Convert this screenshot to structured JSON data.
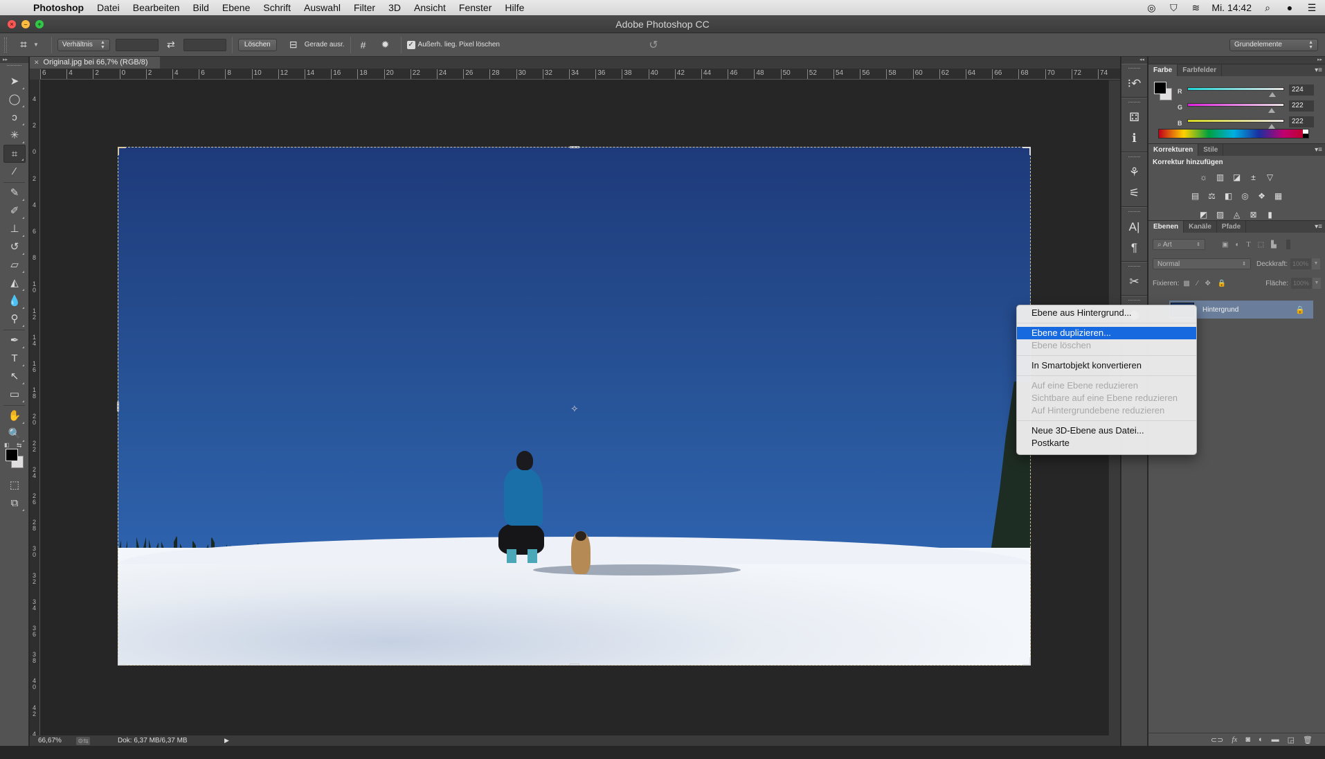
{
  "menubar": {
    "app_name": "Photoshop",
    "items": [
      "Datei",
      "Bearbeiten",
      "Bild",
      "Ebene",
      "Schrift",
      "Auswahl",
      "Filter",
      "3D",
      "Ansicht",
      "Fenster",
      "Hilfe"
    ],
    "clock": "Mi. 14:42",
    "status_icons": [
      "creative-cloud-icon",
      "shield-icon",
      "wifi-icon",
      "spotlight-icon",
      "siri-icon",
      "notification-center-icon"
    ]
  },
  "window": {
    "title": "Adobe Photoshop CC"
  },
  "options_bar": {
    "ratio_select": "Verhältnis",
    "width_value": "",
    "height_value": "",
    "clear_button": "Löschen",
    "straighten_label": "Gerade ausr.",
    "delete_cropped_label": "Außerh. lieg. Pixel löschen",
    "delete_cropped_checked": true,
    "workspace_select": "Grundelemente"
  },
  "document": {
    "tab_title": "Original.jpg bei 66,7% (RGB/8)",
    "zoom": "66,67%",
    "doc_size": "Dok: 6,37 MB/6,37 MB"
  },
  "rulers": {
    "top_labels": [
      "6",
      "4",
      "2",
      "0",
      "2",
      "4",
      "6",
      "8",
      "10",
      "12",
      "14",
      "16",
      "18",
      "20",
      "22",
      "24",
      "26",
      "28",
      "30",
      "32",
      "34",
      "36",
      "38",
      "40",
      "42",
      "44",
      "46",
      "48",
      "50",
      "52",
      "54",
      "56",
      "58",
      "60",
      "62",
      "64",
      "66",
      "68",
      "70",
      "72",
      "74"
    ],
    "left_labels": [
      "4",
      "2",
      "0",
      "2",
      "4",
      "6",
      "8",
      "10",
      "12",
      "14",
      "16",
      "18",
      "20",
      "22",
      "24",
      "26",
      "28",
      "30",
      "32",
      "34",
      "36",
      "38",
      "40",
      "42",
      "4"
    ]
  },
  "tools": [
    {
      "name": "move-tool",
      "glyph": "➤"
    },
    {
      "name": "marquee-tool",
      "glyph": "◯"
    },
    {
      "name": "lasso-tool",
      "glyph": "ↄ"
    },
    {
      "name": "magic-wand-tool",
      "glyph": "✳"
    },
    {
      "name": "crop-tool",
      "glyph": "⌗",
      "active": true
    },
    {
      "name": "eyedropper-tool",
      "glyph": "⁄"
    },
    {
      "name": "healing-brush-tool",
      "glyph": "✎"
    },
    {
      "name": "brush-tool",
      "glyph": "✐"
    },
    {
      "name": "clone-stamp-tool",
      "glyph": "⊥"
    },
    {
      "name": "history-brush-tool",
      "glyph": "↺"
    },
    {
      "name": "eraser-tool",
      "glyph": "▱"
    },
    {
      "name": "paint-bucket-tool",
      "glyph": "◭"
    },
    {
      "name": "blur-tool",
      "glyph": "💧"
    },
    {
      "name": "dodge-tool",
      "glyph": "⚲"
    },
    {
      "name": "pen-tool",
      "glyph": "✒"
    },
    {
      "name": "type-tool",
      "glyph": "T"
    },
    {
      "name": "path-selection-tool",
      "glyph": "↖"
    },
    {
      "name": "rectangle-tool",
      "glyph": "▭"
    },
    {
      "name": "hand-tool",
      "glyph": "✋"
    },
    {
      "name": "zoom-tool",
      "glyph": "🔍"
    }
  ],
  "panels": {
    "color": {
      "tabs": [
        "Farbe",
        "Farbfelder"
      ],
      "active_tab": "Farbe",
      "channels": [
        {
          "label": "R",
          "value": "224",
          "fraction": 0.878,
          "color": "#20d8d8"
        },
        {
          "label": "G",
          "value": "222",
          "fraction": 0.871,
          "color": "#e020e0"
        },
        {
          "label": "B",
          "value": "222",
          "fraction": 0.871,
          "color": "#d8d820"
        }
      ],
      "foreground": "#000000",
      "background": "#e0dede"
    },
    "adjustments": {
      "tabs": [
        "Korrekturen",
        "Stile"
      ],
      "active_tab": "Korrekturen",
      "title": "Korrektur hinzufügen",
      "rows": [
        [
          "brightness-contrast-icon",
          "levels-icon",
          "curves-icon",
          "exposure-icon",
          "vibrance-icon"
        ],
        [
          "hue-saturation-icon",
          "color-balance-icon",
          "black-white-icon",
          "photo-filter-icon",
          "channel-mixer-icon",
          "color-lookup-icon"
        ],
        [
          "invert-icon",
          "posterize-icon",
          "threshold-icon",
          "selective-color-icon",
          "gradient-map-icon"
        ]
      ]
    },
    "layers": {
      "tabs": [
        "Ebenen",
        "Kanäle",
        "Pfade"
      ],
      "active_tab": "Ebenen",
      "filter_kind": "Art",
      "blend_mode": "Normal",
      "opacity_label": "Deckkraft:",
      "opacity_value": "100%",
      "lock_label": "Fixieren:",
      "fill_label": "Fläche:",
      "fill_value": "100%",
      "items": [
        {
          "name": "Hintergrund",
          "locked": true,
          "selected": true
        }
      ]
    }
  },
  "context_menu": {
    "items": [
      {
        "label": "Ebene aus Hintergrund...",
        "enabled": true
      },
      {
        "separator": true
      },
      {
        "label": "Ebene duplizieren...",
        "enabled": true,
        "highlighted": true
      },
      {
        "label": "Ebene löschen",
        "enabled": false
      },
      {
        "separator": true
      },
      {
        "label": "In Smartobjekt konvertieren",
        "enabled": true
      },
      {
        "separator": true
      },
      {
        "label": "Auf eine Ebene reduzieren",
        "enabled": false
      },
      {
        "label": "Sichtbare auf eine Ebene reduzieren",
        "enabled": false
      },
      {
        "label": "Auf Hintergrundebene reduzieren",
        "enabled": false
      },
      {
        "separator": true
      },
      {
        "label": "Neue 3D-Ebene aus Datei...",
        "enabled": true
      },
      {
        "label": "Postkarte",
        "enabled": true
      }
    ]
  }
}
